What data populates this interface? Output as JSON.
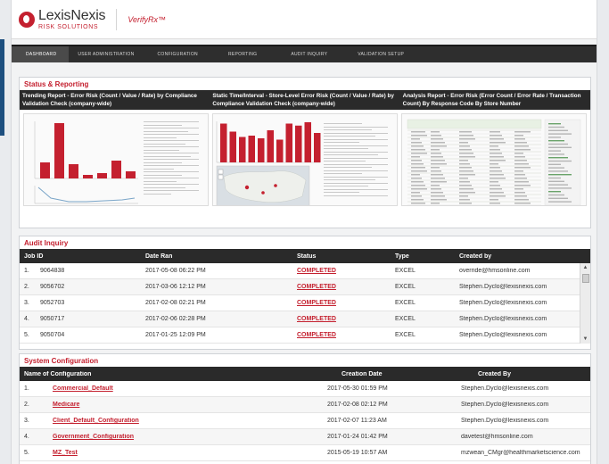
{
  "header": {
    "logo_name": "LexisNexis",
    "logo_sub": "RISK SOLUTIONS",
    "product": "VerifyRx™"
  },
  "nav": {
    "items": [
      {
        "label": "DASHBOARD"
      },
      {
        "label": "USER ADMINISTRATION"
      },
      {
        "label": "CONFIGURATION"
      },
      {
        "label": "REPORTING"
      },
      {
        "label": "AUDIT INQUIRY"
      },
      {
        "label": "VALIDATION SETUP"
      }
    ]
  },
  "status_reporting": {
    "title": "Status & Reporting",
    "reports": [
      {
        "title": "Trending Report - Error Risk (Count / Value / Rate) by Compliance Validation Check (company-wide)"
      },
      {
        "title": "Static Time/Interval - Store-Level Error Risk (Count / Value / Rate) by Compliance Validation Check (company-wide)"
      },
      {
        "title": "Analysis Report - Error Risk (Error Count / Error Rate / Transaction Count) By Response Code By Store Number"
      }
    ],
    "chart1_bars": [
      18,
      62,
      16,
      4,
      6,
      20,
      8
    ],
    "chart2_bars": [
      58,
      46,
      38,
      40,
      36,
      48,
      34,
      58,
      55,
      60,
      44
    ],
    "accent": "#c4202f"
  },
  "audit_inquiry": {
    "title": "Audit Inquiry",
    "columns": [
      "Job ID",
      "Date Ran",
      "Status",
      "Type",
      "Created by"
    ],
    "rows": [
      {
        "n": "1.",
        "job": "9064838",
        "date": "2017-05-08 06:22 PM",
        "status": "COMPLETED",
        "type": "EXCEL",
        "by": "override@hmsonline.com"
      },
      {
        "n": "2.",
        "job": "9056702",
        "date": "2017-03-06 12:12 PM",
        "status": "COMPLETED",
        "type": "EXCEL",
        "by": "Stephen.Dyclo@lexisnexis.com"
      },
      {
        "n": "3.",
        "job": "9052703",
        "date": "2017-02-08 02:21 PM",
        "status": "COMPLETED",
        "type": "EXCEL",
        "by": "Stephen.Dyclo@lexisnexis.com"
      },
      {
        "n": "4.",
        "job": "9050717",
        "date": "2017-02-06 02:28 PM",
        "status": "COMPLETED",
        "type": "EXCEL",
        "by": "Stephen.Dyclo@lexisnexis.com"
      },
      {
        "n": "5.",
        "job": "9050704",
        "date": "2017-01-25 12:09 PM",
        "status": "COMPLETED",
        "type": "EXCEL",
        "by": "Stephen.Dyclo@lexisnexis.com"
      }
    ]
  },
  "system_configuration": {
    "title": "System Configuration",
    "columns": [
      "Name of Configuration",
      "Creation Date",
      "Created By"
    ],
    "rows": [
      {
        "n": "1.",
        "name": "Commercial_Default",
        "date": "2017-05-30 01:59 PM",
        "by": "Stephen.Dyclo@lexisnexis.com"
      },
      {
        "n": "2.",
        "name": "Medicare",
        "date": "2017-02-08 02:12 PM",
        "by": "Stephen.Dyclo@lexisnexis.com"
      },
      {
        "n": "3.",
        "name": "Client_Default_Configuration",
        "date": "2017-02-07 11:23 AM",
        "by": "Stephen.Dyclo@lexisnexis.com"
      },
      {
        "n": "4.",
        "name": "Government_Configuration",
        "date": "2017-01-24 01:42 PM",
        "by": "davetest@hmsonline.com"
      },
      {
        "n": "5.",
        "name": "MZ_Test",
        "date": "2015-05-19 10:57 AM",
        "by": "mzwean_CMgr@healthmarketscience.com"
      }
    ]
  }
}
